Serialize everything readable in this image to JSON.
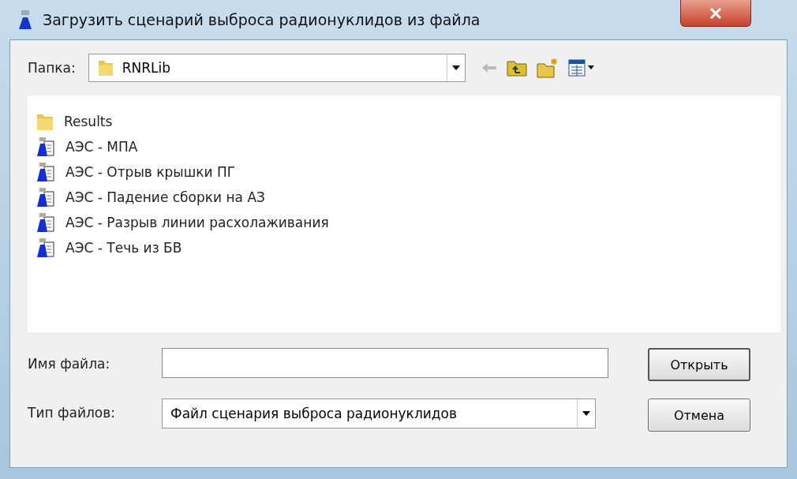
{
  "window": {
    "title": "Загрузить сценарий выброса радионуклидов из файла"
  },
  "folder": {
    "label": "Папка:",
    "value": "RNRLib"
  },
  "files": [
    {
      "name": "Results",
      "kind": "folder",
      "selected": false
    },
    {
      "name": "АЭС - МПА",
      "kind": "scenario",
      "selected": false
    },
    {
      "name": "АЭС - Отрыв крышки ПГ",
      "kind": "scenario",
      "selected": false
    },
    {
      "name": "АЭС - Падение сборки на АЗ",
      "kind": "scenario",
      "selected": false
    },
    {
      "name": "АЭС - Разрыв линии расхолаживания",
      "kind": "scenario",
      "selected": false
    },
    {
      "name": "АЭС - Течь из БВ",
      "kind": "scenario",
      "selected": false
    }
  ],
  "file_name": {
    "label": "Имя файла:"
  },
  "file_type": {
    "label": "Тип файлов:",
    "value": "Файл сценария выброса радионуклидов"
  },
  "buttons": [
    "Открыть",
    "Отмена"
  ]
}
